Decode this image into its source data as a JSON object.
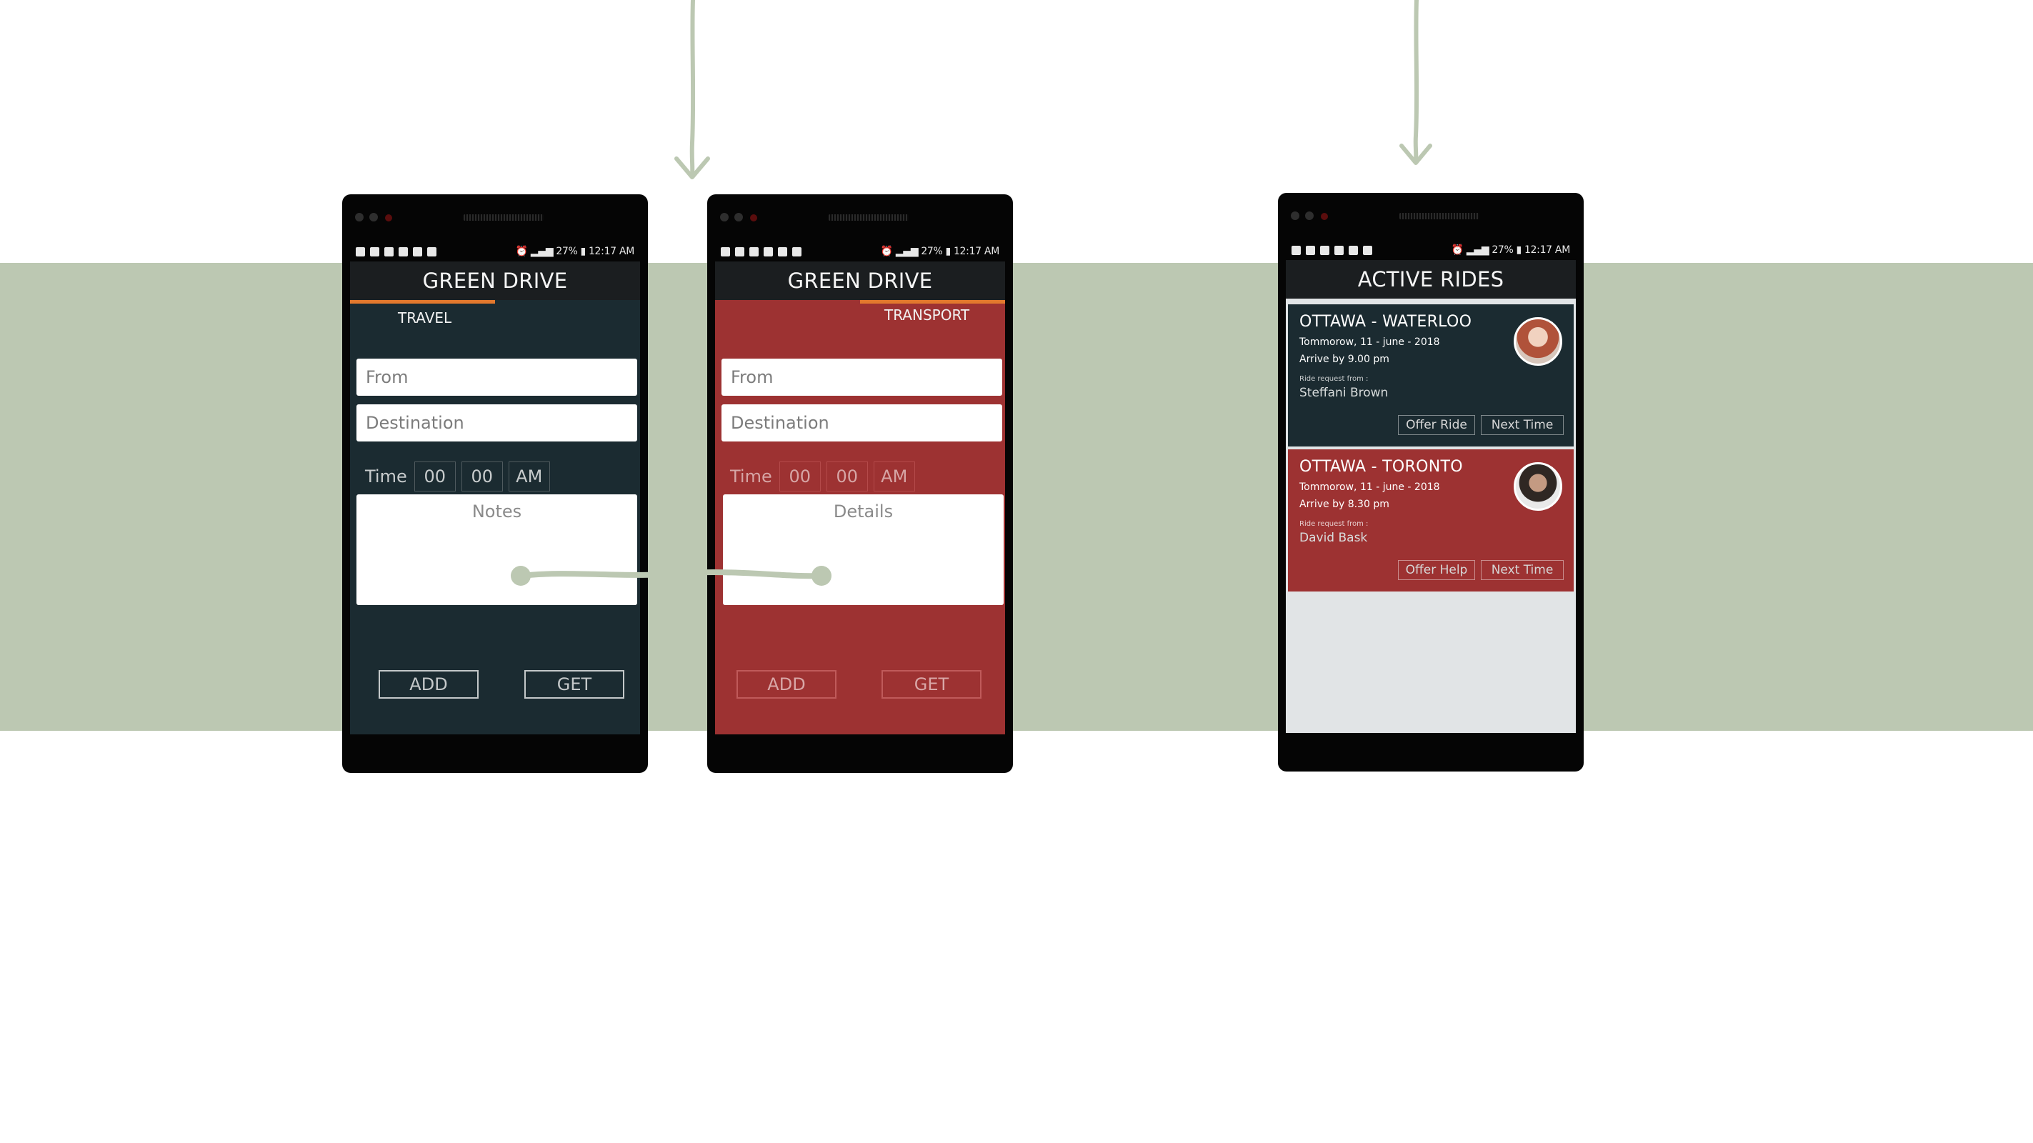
{
  "colors": {
    "band": "#bcc8b2",
    "dark_screen": "#1b2b31",
    "red_screen": "#9d3232",
    "accent_tab": "#e2782d",
    "connector": "#bcc8b2",
    "rides_bg": "#e1e4e6"
  },
  "status_bar": {
    "battery": "27%",
    "time": "12:17 AM",
    "icons": [
      "facebook-icon",
      "facebook-icon",
      "facebook-icon",
      "message-icon",
      "usb-icon",
      "android-icon",
      "alarm-icon",
      "wifi-icon",
      "signal-icon",
      "battery-icon"
    ]
  },
  "screen_travel": {
    "title": "GREEN DRIVE",
    "tab": "TRAVEL",
    "from_placeholder": "From",
    "destination_placeholder": "Destination",
    "time_label": "Time",
    "hour": "00",
    "minute": "00",
    "ampm": "AM",
    "notes_label": "Notes",
    "add_label": "ADD",
    "get_label": "GET"
  },
  "screen_transport": {
    "title": "GREEN DRIVE",
    "tab": "TRANSPORT",
    "from_placeholder": "From",
    "destination_placeholder": "Destination",
    "time_label": "Time",
    "hour": "00",
    "minute": "00",
    "ampm": "AM",
    "details_label": "Details",
    "add_label": "ADD",
    "get_label": "GET"
  },
  "screen_rides": {
    "title": "ACTIVE RIDES",
    "rides": [
      {
        "route": "OTTAWA - WATERLOO",
        "date": "Tommorow, 11 - june - 2018",
        "arrive": "Arrive by 9.00 pm",
        "request_label": "Ride request from :",
        "requester": "Steffani Brown",
        "action": "Offer Ride",
        "secondary": "Next Time",
        "color": "#1b2b31"
      },
      {
        "route": "OTTAWA - TORONTO",
        "date": "Tommorow, 11 - june - 2018",
        "arrive": "Arrive by 8.30 pm",
        "request_label": "Ride request from :",
        "requester": "David Bask",
        "action": "Offer Help",
        "secondary": "Next Time",
        "color": "#9d3232"
      }
    ]
  }
}
